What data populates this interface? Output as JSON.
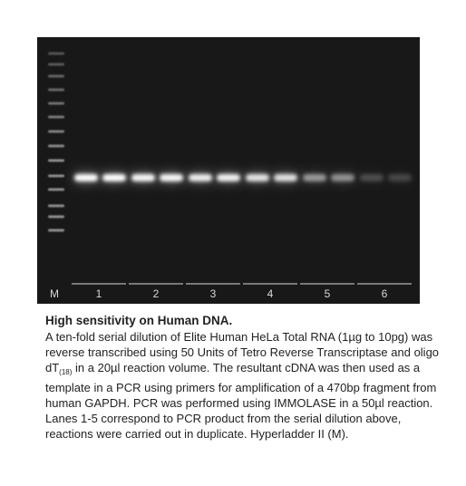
{
  "figure": {
    "gel": {
      "background": "#181818",
      "band_color": "#ffffff",
      "marker_label": "M",
      "lanes": [
        {
          "label": "1",
          "intensity": [
            1.0,
            1.0
          ]
        },
        {
          "label": "2",
          "intensity": [
            0.96,
            0.96
          ]
        },
        {
          "label": "3",
          "intensity": [
            0.9,
            0.92
          ]
        },
        {
          "label": "4",
          "intensity": [
            0.85,
            0.82
          ]
        },
        {
          "label": "5",
          "intensity": [
            0.45,
            0.42
          ]
        },
        {
          "label": "6",
          "intensity": [
            0.12,
            0.1
          ]
        }
      ]
    }
  },
  "caption": {
    "title": "High sensitivity on Human DNA.",
    "text_before_sub": "A ten-fold serial dilution of Elite Human HeLa Total RNA (1µg to 10pg) was reverse transcribed using 50 Units of Tetro Reverse Transcriptase and oligo dT",
    "subscript": "(18)",
    "text_after_sub": " in a 20µl reaction volume. The resultant cDNA was then used as a template in a PCR using primers for amplification of a 470bp fragment from human GAPDH. PCR was performed using IMMOLASE in a 50µl reaction. Lanes 1-5 correspond to PCR product from the serial dilution above, reactions were carried out in duplicate. Hyperladder II (M)."
  }
}
